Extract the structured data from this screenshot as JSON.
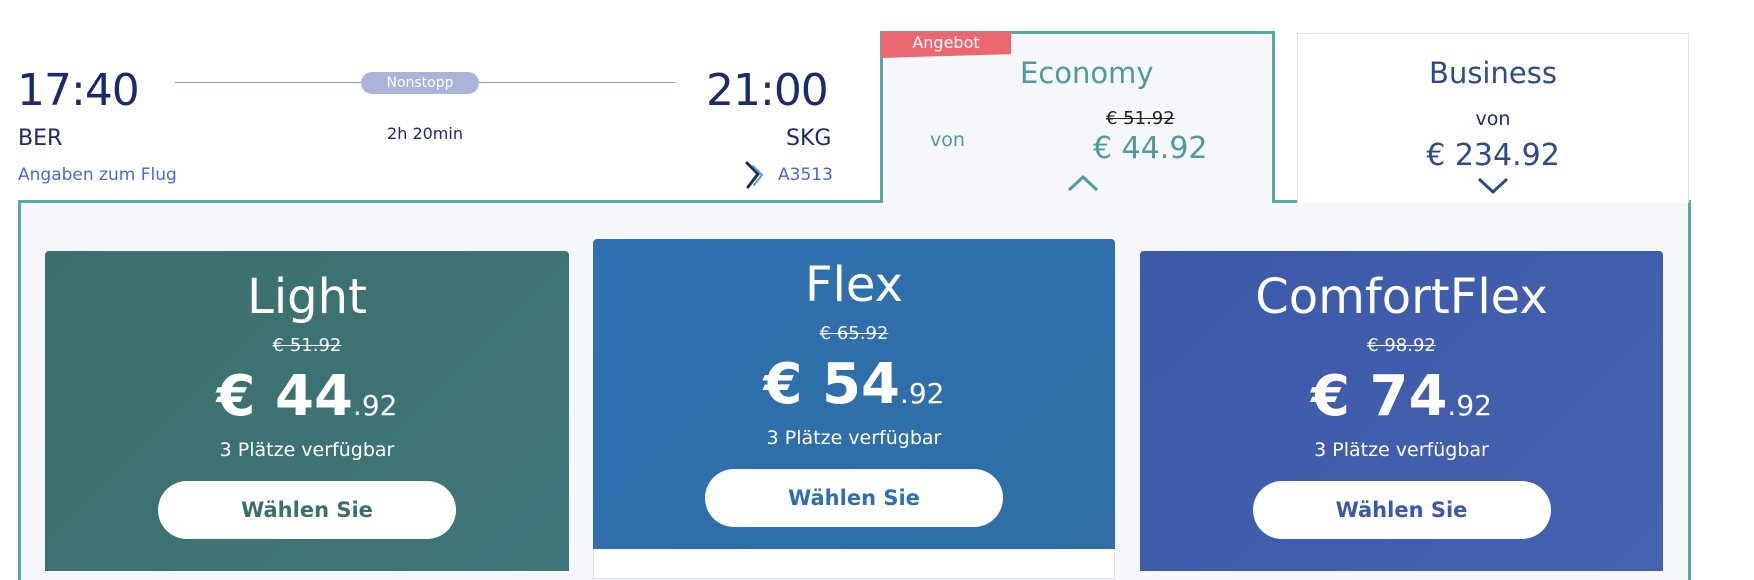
{
  "flight": {
    "departure_time": "17:40",
    "departure_airport": "BER",
    "arrival_time": "21:00",
    "arrival_airport": "SKG",
    "nonstop_label": "Nonstopp",
    "duration": "2h 20min",
    "details_link": "Angaben zum Flug",
    "flight_number": "A3513",
    "airline_icon": "aegean-logo-icon"
  },
  "cabins": {
    "economy": {
      "badge": "Angebot",
      "label": "Economy",
      "from_label": "von",
      "old_price": "€ 51.92",
      "price": "€ 44.92",
      "chevron": "chevron-up-icon"
    },
    "business": {
      "label": "Business",
      "from_label": "von",
      "price": "€ 234.92",
      "chevron": "chevron-down-icon"
    }
  },
  "fares": [
    {
      "name": "Light",
      "old_price": "€ 51.92",
      "price_main": "€ 44",
      "price_cents": ".92",
      "seats": "3 Plätze verfügbar",
      "button": "Wählen Sie",
      "color": "#3a6f6c"
    },
    {
      "name": "Flex",
      "old_price": "€ 65.92",
      "price_main": "€ 54",
      "price_cents": ".92",
      "seats": "3 Plätze verfügbar",
      "button": "Wählen Sie",
      "color": "#2e6fb0"
    },
    {
      "name": "ComfortFlex",
      "old_price": "€ 98.92",
      "price_main": "€ 74",
      "price_cents": ".92",
      "seats": "3 Plätze verfügbar",
      "button": "Wählen Sie",
      "color": "#3b59a8"
    }
  ],
  "colors": {
    "navy": "#1a2a6c",
    "teal_accent": "#5aa7a8",
    "offer_red": "#ec6870",
    "link_blue": "#4a68d8"
  }
}
